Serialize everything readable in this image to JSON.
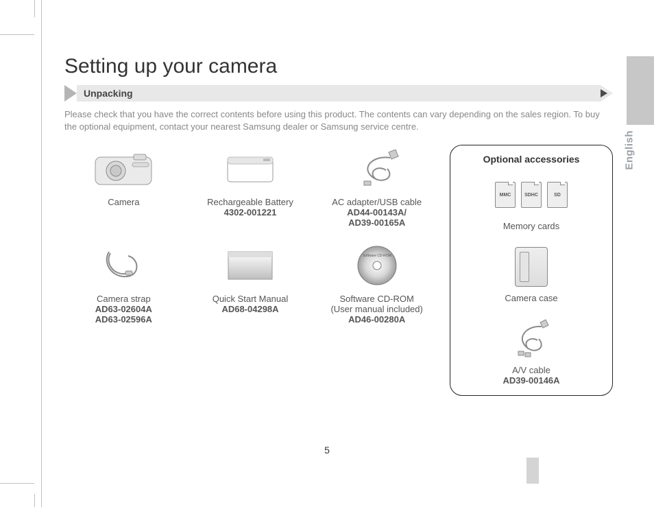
{
  "page": {
    "number": "5",
    "title": "Setting up your camera",
    "section": "Unpacking",
    "language": "English",
    "intro": "Please check that you have the correct contents before using this product. The contents can vary depending on the sales region. To buy the optional equipment, contact your nearest Samsung dealer or Samsung service centre."
  },
  "items": [
    {
      "name": "Camera",
      "sub": "",
      "codes": []
    },
    {
      "name": "Rechargeable Battery",
      "sub": "",
      "codes": [
        "4302-001221"
      ]
    },
    {
      "name": "AC adapter/USB cable",
      "sub": "",
      "codes": [
        "AD44-00143A/",
        "AD39-00165A"
      ]
    },
    {
      "name": "Camera strap",
      "sub": "",
      "codes": [
        "AD63-02604A",
        "AD63-02596A"
      ]
    },
    {
      "name": "Quick Start Manual",
      "sub": "",
      "codes": [
        "AD68-04298A"
      ]
    },
    {
      "name": "Software CD-ROM",
      "sub": "(User manual included)",
      "codes": [
        "AD46-00280A"
      ]
    }
  ],
  "optional": {
    "heading": "Optional accessories",
    "cards": [
      "MMC",
      "SDHC",
      "SD"
    ],
    "cells": [
      {
        "name": "Memory cards",
        "codes": []
      },
      {
        "name": "Camera case",
        "codes": []
      },
      {
        "name": "A/V cable",
        "codes": [
          "AD39-00146A"
        ]
      }
    ]
  }
}
